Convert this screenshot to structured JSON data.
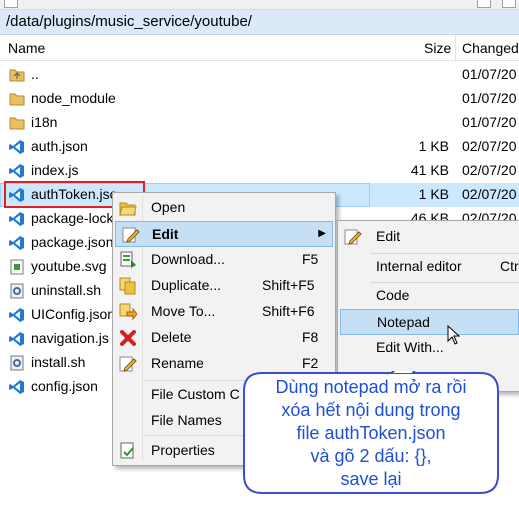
{
  "path": "/data/plugins/music_service/youtube/",
  "columns": {
    "name": "Name",
    "size": "Size",
    "changed": "Changed"
  },
  "files": [
    {
      "name": "..",
      "size": "",
      "changed": "01/07/20",
      "icon": "folder-up-icon"
    },
    {
      "name": "node_modules",
      "size": "",
      "changed": "01/07/20",
      "icon": "folder-icon"
    },
    {
      "name": "i18n",
      "size": "",
      "changed": "01/07/20",
      "icon": "folder-icon"
    },
    {
      "name": "auth.json",
      "size": "1 KB",
      "changed": "02/07/20",
      "icon": "vscode-file-icon"
    },
    {
      "name": "index.js",
      "size": "41 KB",
      "changed": "02/07/20",
      "icon": "js-file-icon"
    },
    {
      "name": "authToken.json",
      "size": "1 KB",
      "changed": "02/07/20",
      "icon": "vscode-file-icon"
    },
    {
      "name": "package-lock.json",
      "size": "46 KB",
      "changed": "02/07/20",
      "icon": "vscode-file-icon"
    },
    {
      "name": "package.json",
      "size": "",
      "changed": "",
      "icon": "vscode-file-icon"
    },
    {
      "name": "youtube.svg",
      "size": "",
      "changed": "",
      "icon": "svg-file-icon"
    },
    {
      "name": "uninstall.sh",
      "size": "",
      "changed": "",
      "icon": "script-file-icon"
    },
    {
      "name": "UIConfig.json",
      "size": "",
      "changed": "",
      "icon": "vscode-file-icon"
    },
    {
      "name": "navigation.js",
      "size": "",
      "changed": "",
      "icon": "vscode-file-icon"
    },
    {
      "name": "install.sh",
      "size": "",
      "changed": "",
      "icon": "script-file-icon"
    },
    {
      "name": "config.json",
      "size": "",
      "changed": "",
      "icon": "vscode-file-icon"
    }
  ],
  "context_menu": {
    "open": "Open",
    "edit": "Edit",
    "download": "Download...",
    "download_key": "F5",
    "duplicate": "Duplicate...",
    "duplicate_key": "Shift+F5",
    "move": "Move To...",
    "move_key": "Shift+F6",
    "delete": "Delete",
    "delete_key": "F8",
    "rename": "Rename",
    "rename_key": "F2",
    "file_custom": "File Custom C",
    "file_names": "File Names",
    "properties": "Properties"
  },
  "submenu": {
    "edit": "Edit",
    "internal_editor": "Internal editor",
    "internal_editor_key": "Ctr",
    "code": "Code",
    "notepad": "Notepad",
    "edit_with": "Edit With..."
  },
  "callout": {
    "lines": [
      "Dùng notepad mở ra rồi",
      "xóa hết  nội dung trong",
      "file authToken.json",
      "và gõ 2 dấu: {},",
      "save lại"
    ]
  },
  "colors": {
    "selection": "#cce8ff",
    "highlight": "#c5dff5",
    "callout_text": "#1f4fd8",
    "red_box": "#e02020"
  }
}
